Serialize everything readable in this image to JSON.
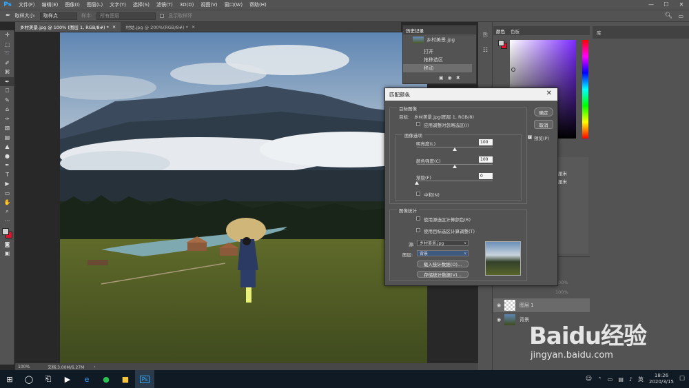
{
  "app": {
    "logo": "Ps"
  },
  "menubar": {
    "items": [
      "文件(F)",
      "编辑(E)",
      "图像(I)",
      "图层(L)",
      "文字(Y)",
      "选择(S)",
      "滤镜(T)",
      "3D(D)",
      "视图(V)",
      "窗口(W)",
      "帮助(H)"
    ],
    "controls": [
      "—",
      "☐",
      "✕"
    ]
  },
  "options": {
    "sample_size_label": "取样大小:",
    "sample_size_value": "取样点",
    "sample_label": "样本:",
    "sample_value": "所有图层",
    "show_ring_label": "显示取样环"
  },
  "tabs": [
    {
      "label": "乡村美景.jpg @ 100% (图层 1, RGB/8#) *",
      "close": "×"
    },
    {
      "label": "村姑.jpg @ 200%(RGB/8#) *",
      "close": "×"
    }
  ],
  "status": {
    "zoom": "100%",
    "doc": "文档:3.00M/6.27M",
    "arrow": "›"
  },
  "history": {
    "tab": "历史记录",
    "snapshot": "乡村美景.jpg",
    "items": [
      "打开",
      "拖移选区",
      "移动"
    ]
  },
  "color_panel": {
    "tabs": [
      "颜色",
      "色板"
    ]
  },
  "library_tab": "库",
  "layers": {
    "items": [
      "图层 1",
      "背景"
    ],
    "opacity": "100%",
    "fill": "100%"
  },
  "units": [
    "厘米",
    "厘米"
  ],
  "dialog": {
    "title": "匹配颜色",
    "close": "✕",
    "target_group": "目标图像",
    "target_label": "目标:",
    "target_value": "乡村美景.jpg(图层 1, RGB/8)",
    "ignore_selection": "应用调整时忽略选区(I)",
    "options_group": "图像选项",
    "luminance_label": "明亮度(L)",
    "luminance_value": "100",
    "luminance_level": 0.5,
    "intensity_label": "颜色强度(C)",
    "intensity_value": "100",
    "intensity_level": 0.5,
    "fade_label": "渐隐(F)",
    "fade_value": "0",
    "fade_level": 0,
    "neutralize_label": "中和(N)",
    "stats_group": "图像统计",
    "use_source_selection": "使用源选区计算颜色(R)",
    "use_target_selection": "使用目标选区计算调整(T)",
    "source_label": "源:",
    "source_value": "乡村美景.jpg",
    "layer_label": "图层:",
    "layer_value": "背景",
    "load_stats": "载入统计数据(O)...",
    "save_stats": "存储统计数据(V)...",
    "ok": "确定",
    "cancel": "取消",
    "preview_label": "预览(P)",
    "preview_checked": true
  },
  "taskbar": {
    "time": "18:26",
    "date": "2020/3/15",
    "lang": "英"
  },
  "watermark": {
    "text": "Baidu经验",
    "url": "jingyan.baidu.com"
  },
  "colors": {
    "fg": "#d0d0d0",
    "bg": "#e8102a",
    "accent": "#31a8ff"
  }
}
